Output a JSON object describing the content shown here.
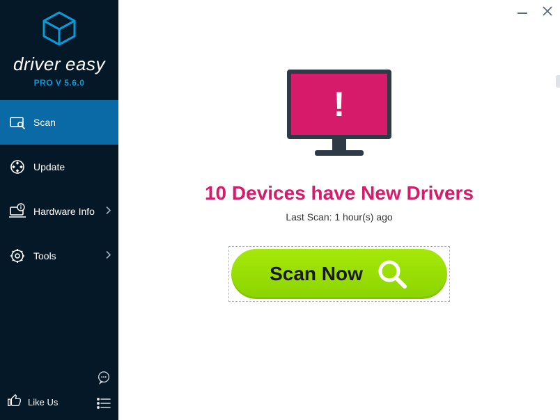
{
  "brand": {
    "name_1": "driver",
    "name_2": "easy",
    "version": "PRO V 5.6.0"
  },
  "sidebar": {
    "items": [
      {
        "label": "Scan",
        "icon": "scan-icon",
        "has_submenu": false,
        "active": true
      },
      {
        "label": "Update",
        "icon": "update-icon",
        "has_submenu": false,
        "active": false
      },
      {
        "label": "Hardware Info",
        "icon": "hardware-info-icon",
        "has_submenu": true,
        "active": false
      },
      {
        "label": "Tools",
        "icon": "tools-icon",
        "has_submenu": true,
        "active": false
      }
    ],
    "like_us_label": "Like Us"
  },
  "main": {
    "headline": "10 Devices have New Drivers",
    "last_scan": "Last Scan: 1 hour(s) ago",
    "scan_button_label": "Scan Now",
    "alert_glyph": "!"
  },
  "colors": {
    "sidebar_bg": "#051827",
    "sidebar_active": "#0a6aa6",
    "accent_pink": "#d51b6a",
    "accent_green": "#9bdc00",
    "brand_blue": "#0a9ad6"
  }
}
